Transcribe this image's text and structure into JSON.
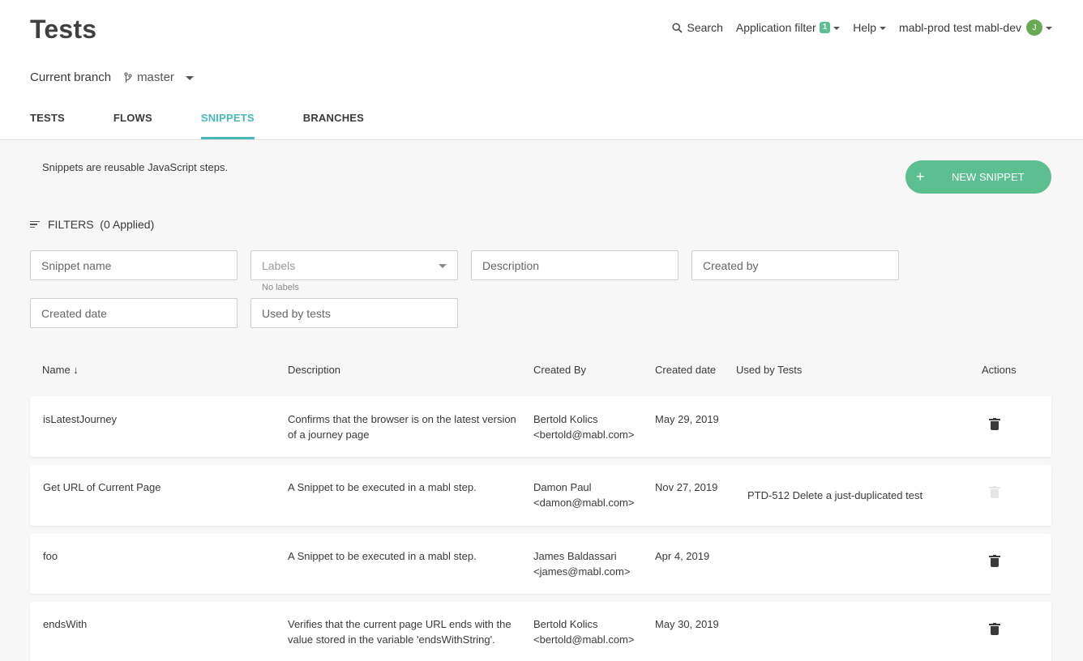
{
  "page": {
    "title": "Tests"
  },
  "topnav": {
    "search_label": "Search",
    "app_filter_label": "Application filter",
    "app_filter_count": "1",
    "help_label": "Help",
    "workspace_label": "mabl-prod test mabl-dev",
    "avatar_initial": "J"
  },
  "branch": {
    "label": "Current branch",
    "value": "master"
  },
  "tabs": [
    {
      "label": "TESTS",
      "active": false
    },
    {
      "label": "FLOWS",
      "active": false
    },
    {
      "label": "SNIPPETS",
      "active": true
    },
    {
      "label": "BRANCHES",
      "active": false
    }
  ],
  "intro": "Snippets are reusable JavaScript steps.",
  "new_snippet_button": {
    "icon": "+",
    "label": "NEW SNIPPET"
  },
  "filters": {
    "toggle_label": "FILTERS  (0 Applied)",
    "snippet_name_placeholder": "Snippet name",
    "labels_placeholder": "Labels",
    "labels_helper": "No labels",
    "description_placeholder": "Description",
    "created_by_placeholder": "Created by",
    "created_date_placeholder": "Created date",
    "used_by_tests_placeholder": "Used by tests"
  },
  "table": {
    "columns": {
      "name": "Name ↓",
      "description": "Description",
      "created_by": "Created By",
      "created_date": "Created date",
      "used_by_tests": "Used by Tests",
      "actions": "Actions"
    },
    "rows": [
      {
        "name": "isLatestJourney",
        "description": "Confirms that the browser is on the latest version of a journey page",
        "created_by_name": "Bertold Kolics",
        "created_by_email": "<bertold@mabl.com>",
        "created_date": "May 29, 2019",
        "used_by_tests": "",
        "delete_enabled": true
      },
      {
        "name": "Get URL of Current Page",
        "description": "A Snippet to be executed in a mabl step.",
        "created_by_name": "Damon Paul",
        "created_by_email": "<damon@mabl.com>",
        "created_date": "Nov 27, 2019",
        "used_by_tests": "PTD-512 Delete a just-duplicated test",
        "delete_enabled": false
      },
      {
        "name": "foo",
        "description": "A Snippet to be executed in a mabl step.",
        "created_by_name": "James Baldassari",
        "created_by_email": "<james@mabl.com>",
        "created_date": "Apr 4, 2019",
        "used_by_tests": "",
        "delete_enabled": true
      },
      {
        "name": "endsWith",
        "description": "Verifies that the current page URL ends with the value stored in the variable 'endsWithString'.",
        "created_by_name": "Bertold Kolics",
        "created_by_email": "<bertold@mabl.com>",
        "created_date": "May 30, 2019",
        "used_by_tests": "",
        "delete_enabled": true
      }
    ]
  },
  "colors": {
    "accent": "#49b8b8",
    "button_green": "#5cbf8f",
    "avatar_green": "#6aaa54"
  },
  "icons": [
    "search-icon",
    "branch-icon",
    "filter-icon",
    "plus-icon",
    "trash-icon",
    "sort-arrow-icon",
    "chevron-down-icon"
  ]
}
